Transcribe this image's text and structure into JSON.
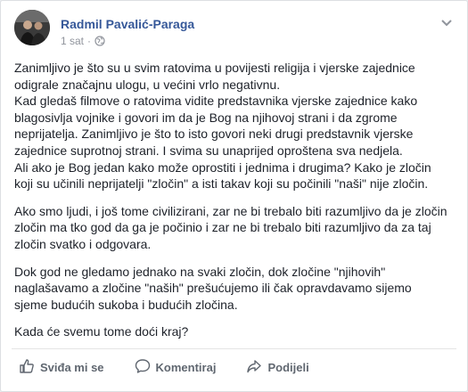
{
  "post": {
    "author": "Radmil Pavalić-Paraga",
    "time": "1 sat",
    "separator": "·",
    "paragraphs": [
      "Zanimljivo je što su u svim ratovima u povijesti religija i vjerske zajednice\nodigrale značajnu ulogu, u većini vrlo negativnu.\nKad gledaš filmove o ratovima vidite predstavnika vjerske zajednice kako\nblagosivlja vojnike i govori im da je Bog na njihovoj strani i da zgrome\nneprijatelja. Zanimljivo je što to isto govori neki drugi predstavnik vjerske\nzajednice suprotnoj strani. I svima su unaprijed oproštena sva nedjela.\nAli ako je Bog jedan kako može oprostiti i jednima i drugima? Kako je zločin\nkoji su učinili neprijatelji \"zločin\" a isti takav koji su počinili \"naši\" nije zločin.",
      "Ako smo ljudi, i još tome civilizirani, zar ne bi trebalo biti razumljivo da je zločin\nzločin ma tko god da ga je počinio i zar ne bi trebalo biti razumljivo da za taj\nzločin svatko i odgovara.",
      "Dok god ne gledamo jednako na svaki zločin, dok zločine \"njihovih\"\nnaglašavamo a zločine \"naših\" prešućujemo ili čak opravdavamo sijemo\nsjeme budućih sukoba i budućih zločina.",
      "Kada će svemu tome doći kraj?"
    ]
  },
  "actions": {
    "like": "Sviđa mi se",
    "comment": "Komentiraj",
    "share": "Podijeli"
  },
  "icons": {
    "globe": "globe-icon",
    "chevron": "chevron-down-icon",
    "like": "thumbs-up-icon",
    "comment": "comment-icon",
    "share": "share-arrow-icon"
  },
  "colors": {
    "author": "#365899",
    "text": "#1d2129",
    "meta": "#90949c",
    "action": "#606770"
  }
}
